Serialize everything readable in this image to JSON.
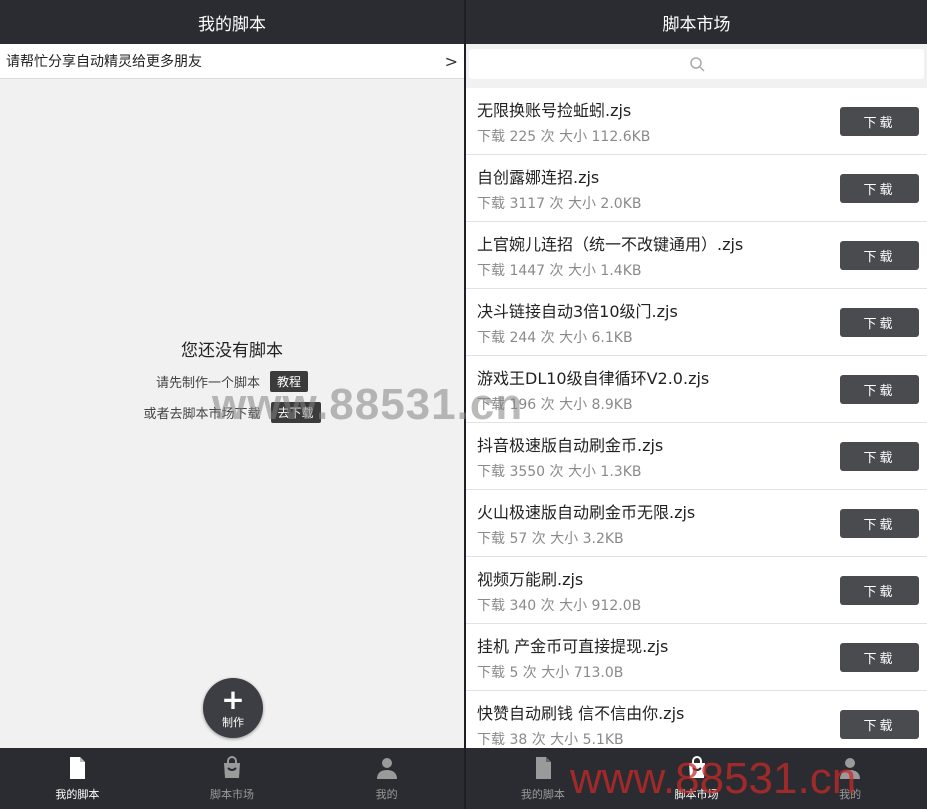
{
  "left": {
    "title": "我的脚本",
    "share_text": "请帮忙分享自动精灵给更多朋友",
    "share_chevron": ">",
    "empty_title": "您还没有脚本",
    "empty_line1": "请先制作一个脚本",
    "empty_line1_tag": "教程",
    "empty_line2": "或者去脚本市场下载",
    "empty_line2_tag": "去下载",
    "fab_plus": "+",
    "fab_label": "制作",
    "tabs": [
      {
        "label": "我的脚本",
        "icon": "document-icon",
        "active": true
      },
      {
        "label": "脚本市场",
        "icon": "shopping-bag-icon",
        "active": false
      },
      {
        "label": "我的",
        "icon": "user-icon",
        "active": false
      }
    ]
  },
  "right": {
    "title": "脚本市场",
    "search_icon": "search-icon",
    "download_label": "下载",
    "items": [
      {
        "name": "无限换账号捡蚯蚓.zjs",
        "meta": "下载 225 次 大小 112.6KB"
      },
      {
        "name": "自创露娜连招.zjs",
        "meta": "下载 3117 次 大小 2.0KB"
      },
      {
        "name": "上官婉儿连招（统一不改键通用）.zjs",
        "meta": "下载 1447 次 大小 1.4KB"
      },
      {
        "name": "决斗链接自动3倍10级门.zjs",
        "meta": "下载 244 次 大小 6.1KB"
      },
      {
        "name": "游戏王DL10级自律循环V2.0.zjs",
        "meta": "下载 196 次 大小 8.9KB"
      },
      {
        "name": "抖音极速版自动刷金币.zjs",
        "meta": "下载 3550 次 大小 1.3KB"
      },
      {
        "name": "火山极速版自动刷金币无限.zjs",
        "meta": "下载 57 次 大小 3.2KB"
      },
      {
        "name": "视频万能刷.zjs",
        "meta": "下载 340 次 大小 912.0B"
      },
      {
        "name": "挂机 产金币可直接提现.zjs",
        "meta": "下载 5 次 大小 713.0B"
      },
      {
        "name": "快赞自动刷钱 信不信由你.zjs",
        "meta": "下载 38 次 大小 5.1KB"
      }
    ],
    "tabs": [
      {
        "label": "我的脚本",
        "icon": "document-icon",
        "active": false
      },
      {
        "label": "脚本市场",
        "icon": "shopping-bag-icon",
        "active": true
      },
      {
        "label": "我的",
        "icon": "user-icon",
        "active": false
      }
    ]
  },
  "watermark_center": "www.88531.cn",
  "watermark_corner": "www.88531.cn",
  "colors": {
    "titlebar": "#2b2c31",
    "button": "#4a4b4f",
    "background": "#f1f1f1"
  }
}
